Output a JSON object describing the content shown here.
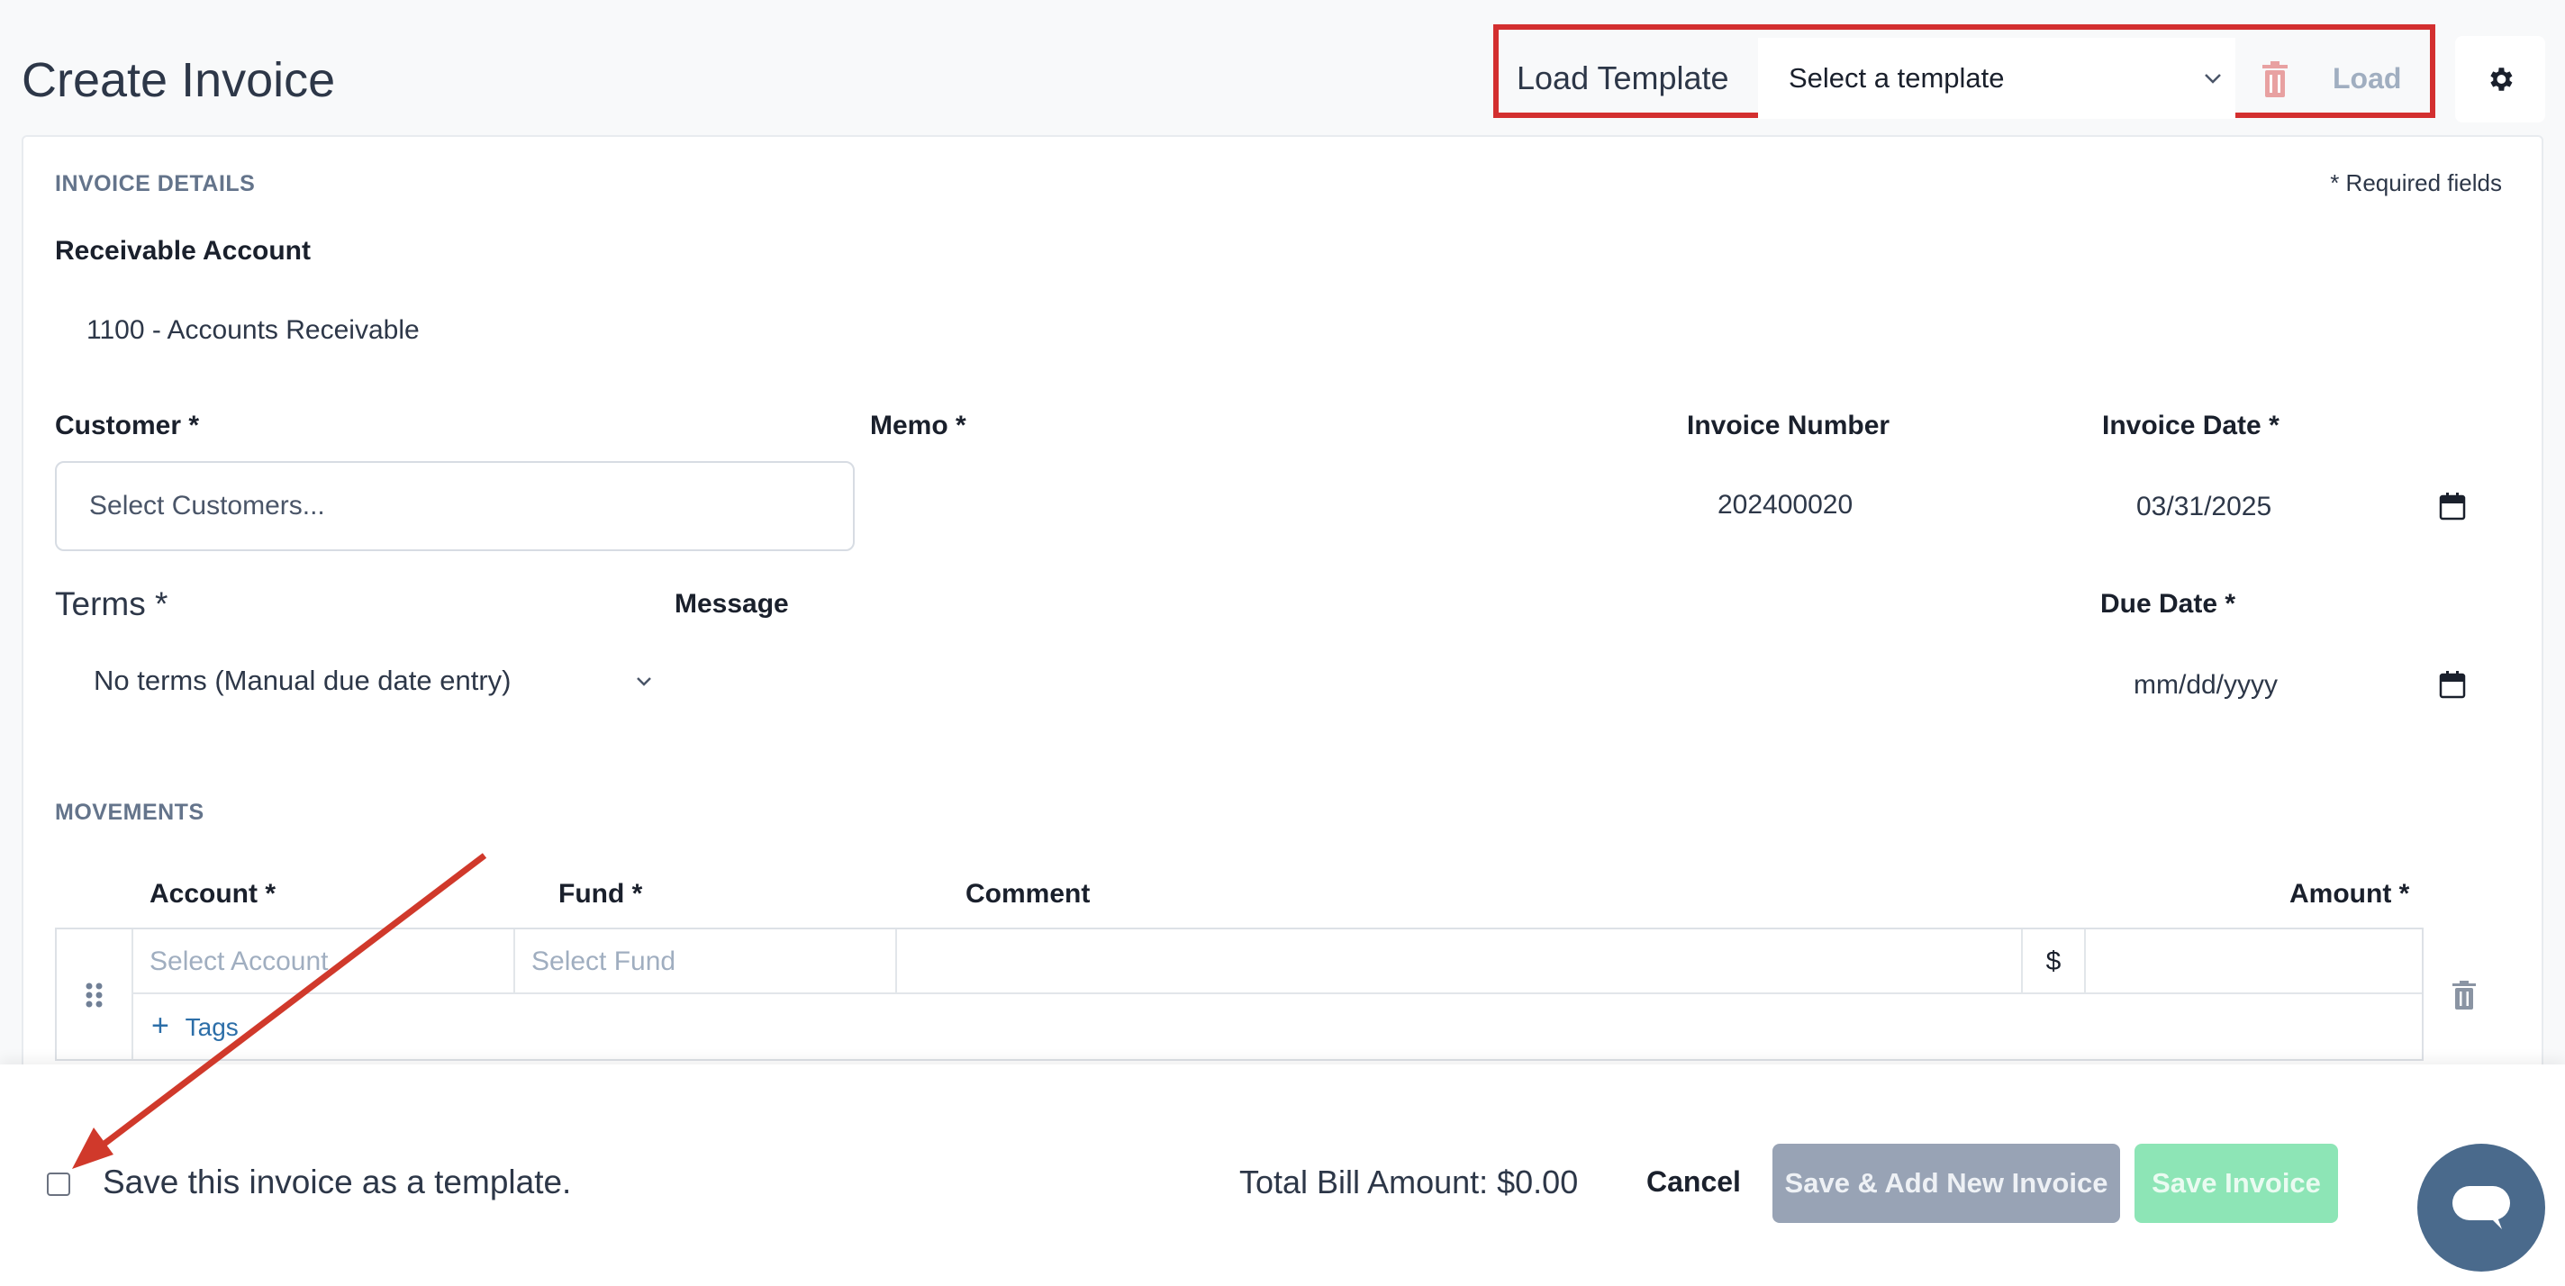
{
  "header": {
    "title": "Create Invoice",
    "load_template_label": "Load Template",
    "template_select_placeholder": "Select a template",
    "load_button": "Load"
  },
  "invoice_details": {
    "section_label": "INVOICE DETAILS",
    "required_note": "* Required fields",
    "receivable_account_label": "Receivable Account",
    "receivable_account_value": "1100 - Accounts Receivable",
    "customer_label": "Customer *",
    "customer_placeholder": "Select Customers...",
    "memo_label": "Memo *",
    "invoice_number_label": "Invoice Number",
    "invoice_number_value": "202400020",
    "invoice_date_label": "Invoice Date *",
    "invoice_date_value": "03/31/2025",
    "terms_label": "Terms *",
    "terms_value": "No terms (Manual due date entry)",
    "message_label": "Message",
    "due_date_label": "Due Date *",
    "due_date_placeholder": "mm/dd/yyyy"
  },
  "movements": {
    "section_label": "MOVEMENTS",
    "columns": {
      "account": "Account *",
      "fund": "Fund *",
      "comment": "Comment",
      "amount": "Amount *"
    },
    "row": {
      "account_placeholder": "Select Account",
      "fund_placeholder": "Select Fund",
      "currency_symbol": "$",
      "tags_link": "Tags"
    }
  },
  "footer": {
    "save_template_label": "Save this invoice as a template.",
    "total_label": "Total Bill Amount: $0.00",
    "cancel": "Cancel",
    "save_and_new": "Save & Add New Invoice",
    "save": "Save Invoice"
  },
  "colors": {
    "highlight_red": "#d32f2f",
    "save_green": "#8de5b6",
    "save_new_gray": "#98a3b5",
    "chat_blue": "#4a6a8c"
  }
}
